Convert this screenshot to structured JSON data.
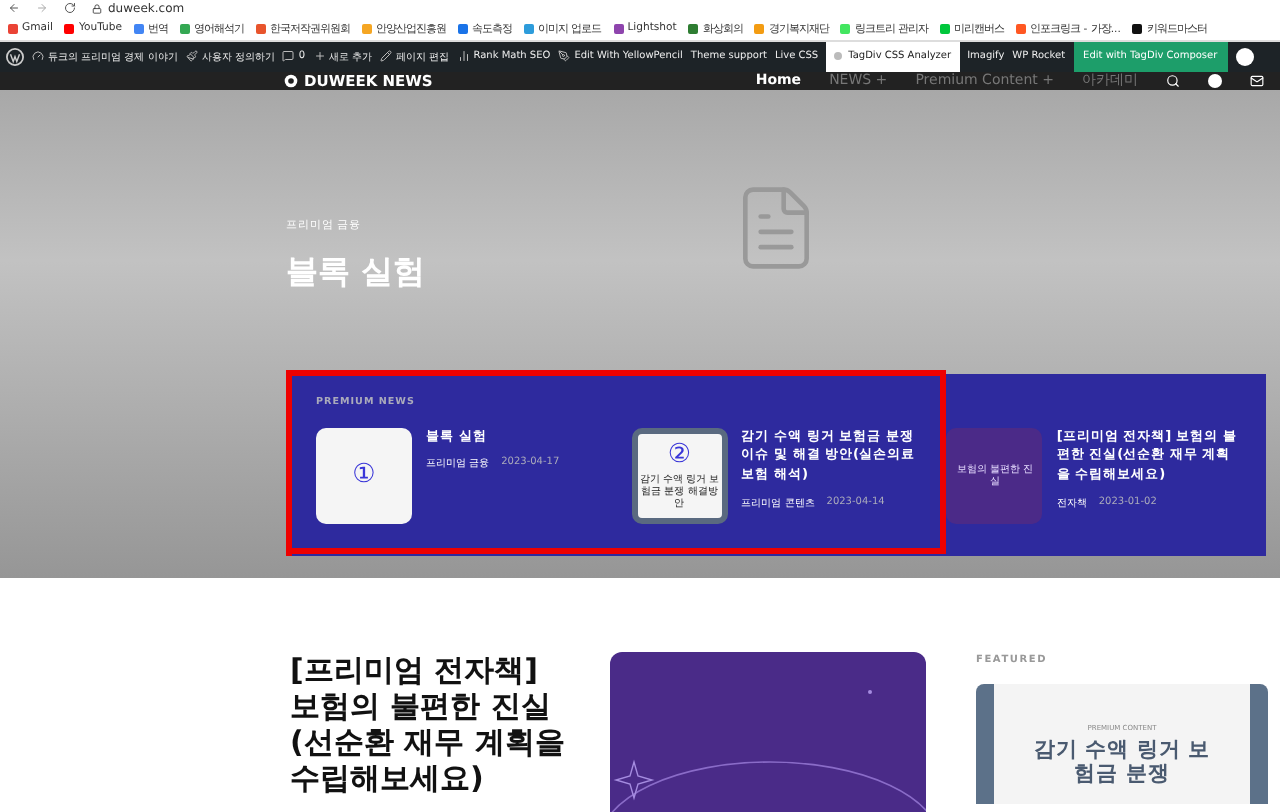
{
  "browser": {
    "url": "duweek.com",
    "bookmarks": [
      {
        "label": "Gmail",
        "color": "#ea4335"
      },
      {
        "label": "YouTube",
        "color": "#ff0000"
      },
      {
        "label": "번역",
        "color": "#4285f4"
      },
      {
        "label": "영어해석기",
        "color": "#34a853"
      },
      {
        "label": "한국저작권위원회",
        "color": "#e8542c"
      },
      {
        "label": "안양산업진흥원",
        "color": "#f5a623"
      },
      {
        "label": "속도측정",
        "color": "#1a73e8"
      },
      {
        "label": "이미지 업로드",
        "color": "#2d9cdb"
      },
      {
        "label": "Lightshot",
        "color": "#8e44ad"
      },
      {
        "label": "화상회의",
        "color": "#2e7d32"
      },
      {
        "label": "경기복지재단",
        "color": "#f39c12"
      },
      {
        "label": "링크트리 관리자",
        "color": "#43e660"
      },
      {
        "label": "미리캔버스",
        "color": "#00c73c"
      },
      {
        "label": "인포크링크 - 가장...",
        "color": "#ff5722"
      },
      {
        "label": "키워드마스터",
        "color": "#111111"
      }
    ]
  },
  "admin_bar": {
    "items": [
      {
        "kind": "logo"
      },
      {
        "kind": "dashboard",
        "label": "듀크의 프리미엄 경제 이야기"
      },
      {
        "kind": "brush",
        "label": "사용자 정의하기"
      },
      {
        "kind": "comment",
        "label": "0"
      },
      {
        "kind": "plus",
        "label": "새로 추가"
      },
      {
        "kind": "pencil",
        "label": "페이지 편집"
      },
      {
        "kind": "chart",
        "label": "Rank Math SEO"
      },
      {
        "kind": "pen",
        "label": "Edit With YellowPencil"
      },
      {
        "kind": "plain",
        "label": "Theme support"
      },
      {
        "kind": "plain",
        "label": "Live CSS"
      },
      {
        "kind": "highlight",
        "label": "TagDiv CSS Analyzer"
      },
      {
        "kind": "plain",
        "label": "Imagify"
      },
      {
        "kind": "plain",
        "label": "WP Rocket"
      },
      {
        "kind": "button",
        "label": "Edit with TagDiv Composer"
      },
      {
        "kind": "avatar"
      }
    ]
  },
  "site_header": {
    "logo": "DUWEEK NEWS",
    "nav": [
      {
        "label": "Home",
        "selected": true
      },
      {
        "label": "NEWS +",
        "selected": false
      },
      {
        "label": "Premium Content +",
        "selected": false
      },
      {
        "label": "아카데미",
        "selected": false
      }
    ]
  },
  "hero": {
    "category": "프리미엄 금융",
    "title": "블록 실험"
  },
  "premium": {
    "heading": "PREMIUM NEWS",
    "items": [
      {
        "title": "블록 실험",
        "category": "프리미엄 금융",
        "date": "2023-04-17",
        "thumb": {
          "kind": "white",
          "mark": "①"
        }
      },
      {
        "title": "감기 수액 링거 보험금 분쟁 이슈 및 해결 방안(실손의료보험 해석)",
        "category": "프리미엄 콘텐츠",
        "date": "2023-04-14",
        "thumb": {
          "kind": "card",
          "mark": "②",
          "text": "감기 수액 링거 보험금 분쟁 해결방안"
        }
      },
      {
        "title": "[프리미엄 전자책] 보험의 불편한 진실(선순환 재무 계획을 수립해보세요)",
        "category": "전자책",
        "date": "2023-01-02",
        "thumb": {
          "kind": "purple",
          "text": "보험의 불편한 진실"
        }
      }
    ]
  },
  "article": {
    "title": "[프리미엄 전자책] 보험의 불편한 진실(선순환 재무 계획을 수립해보세요)"
  },
  "featured": {
    "heading": "FEATURED",
    "card_label": "PREMIUM CONTENT",
    "card_title": "감기 수액 링거 보험금 분쟁"
  }
}
